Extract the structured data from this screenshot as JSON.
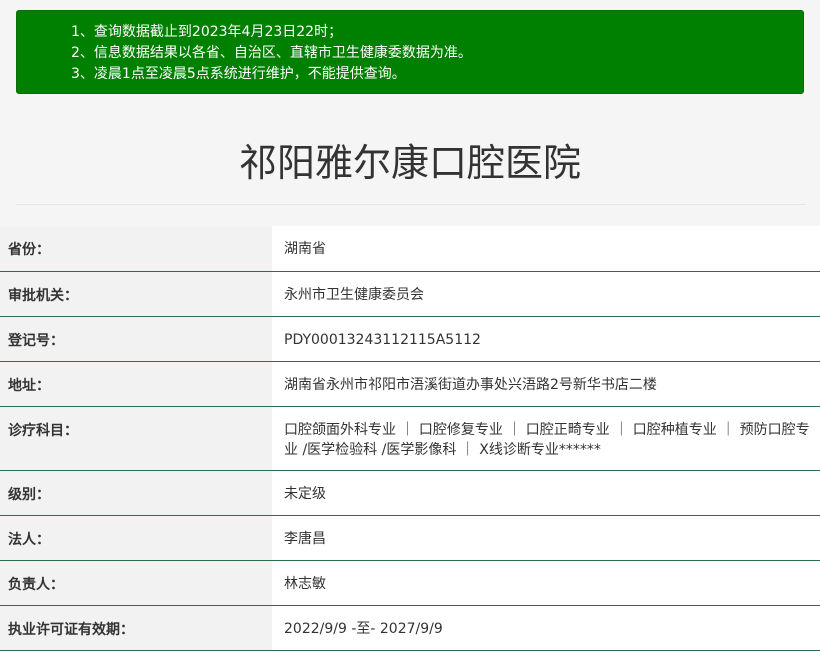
{
  "notice": {
    "lines": [
      "1、查询数据截止到2023年4月23日22时；",
      "2、信息数据结果以各省、自治区、直辖市卫生健康委数据为准。",
      "3、凌晨1点至凌晨5点系统进行维护，不能提供查询。"
    ]
  },
  "page_title": "祁阳雅尔康口腔医院",
  "rows": [
    {
      "label": "省份：",
      "value": "湖南省"
    },
    {
      "label": "审批机关：",
      "value": "永州市卫生健康委员会"
    },
    {
      "label": "登记号：",
      "value": "PDY00013243112115A5112"
    },
    {
      "label": "地址：",
      "value": "湖南省永州市祁阳市浯溪街道办事处兴浯路2号新华书店二楼"
    },
    {
      "label": "诊疗科目：",
      "value": "口腔颌面外科专业 ｜ 口腔修复专业 ｜ 口腔正畸专业 ｜ 口腔种植专业 ｜ 预防口腔专业 /医学检验科 /医学影像科 ｜ X线诊断专业******"
    },
    {
      "label": "级别：",
      "value": "未定级"
    },
    {
      "label": "法人：",
      "value": "李唐昌"
    },
    {
      "label": "负责人：",
      "value": "林志敏"
    },
    {
      "label": "执业许可证有效期：",
      "value": "2022/9/9 -至- 2027/9/9"
    }
  ]
}
